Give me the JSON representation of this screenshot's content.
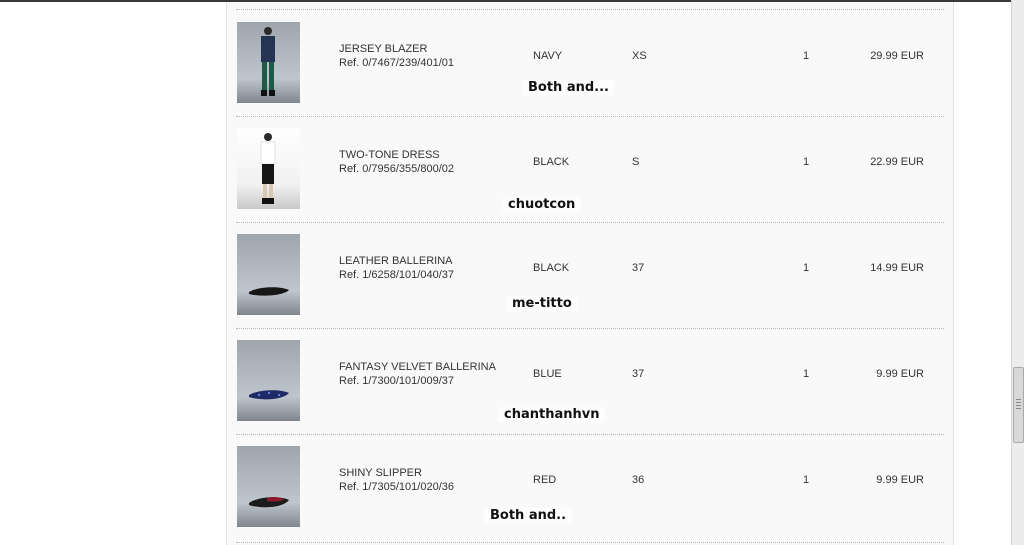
{
  "items": [
    {
      "name": "JERSEY BLAZER",
      "ref": "Ref. 0/7467/239/401/01",
      "color": "NAVY",
      "size": "XS",
      "qty": "1",
      "price": "29.99 EUR",
      "watermark": "Both and...",
      "thumb_icon": "jersey-blazer-image"
    },
    {
      "name": "TWO-TONE DRESS",
      "ref": "Ref. 0/7956/355/800/02",
      "color": "BLACK",
      "size": "S",
      "qty": "1",
      "price": "22.99 EUR",
      "watermark": "chuotcon",
      "thumb_icon": "two-tone-dress-image"
    },
    {
      "name": "LEATHER BALLERINA",
      "ref": "Ref. 1/6258/101/040/37",
      "color": "BLACK",
      "size": "37",
      "qty": "1",
      "price": "14.99 EUR",
      "watermark": "me-titto",
      "thumb_icon": "leather-ballerina-image"
    },
    {
      "name": "FANTASY VELVET BALLERINA",
      "ref": "Ref. 1/7300/101/009/37",
      "color": "BLUE",
      "size": "37",
      "qty": "1",
      "price": "9.99 EUR",
      "watermark": "chanthanhvn",
      "thumb_icon": "velvet-ballerina-image"
    },
    {
      "name": "SHINY SLIPPER",
      "ref": "Ref. 1/7305/101/020/36",
      "color": "RED",
      "size": "36",
      "qty": "1",
      "price": "9.99 EUR",
      "watermark": "Both and..",
      "thumb_icon": "shiny-slipper-image"
    }
  ],
  "colors": {
    "navy": "#253452",
    "black": "#161616",
    "blue": "#1e2a66",
    "red": "#8c1a2a",
    "panel": "#f9f9f9"
  }
}
